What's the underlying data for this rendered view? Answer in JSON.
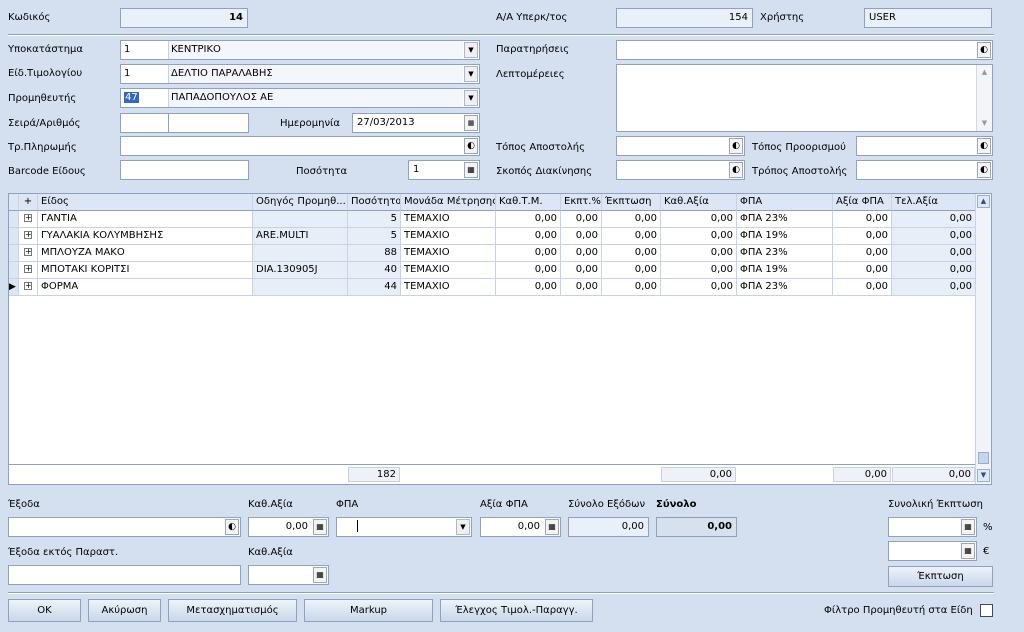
{
  "header": {
    "code_label": "Κωδικός",
    "code_value": "14",
    "aa_label": "Α/Α Υπερκ/τος",
    "aa_value": "154",
    "user_label": "Χρήστης",
    "user_value": "USER"
  },
  "form": {
    "branch_label": "Υποκατάστημα",
    "branch_code": "1",
    "branch_value": "ΚΕΝΤΡΙΚΟ",
    "invtype_label": "Είδ.Τιμολογίου",
    "invtype_code": "1",
    "invtype_value": "ΔΕΛΤΙΟ ΠΑΡΑΛΑΒΗΣ",
    "supplier_label": "Προμηθευτής",
    "supplier_code": "47",
    "supplier_value": "ΠΑΠΑΔΟΠΟΥΛΟΣ ΑΕ",
    "series_label": "Σειρά/Αριθμός",
    "series_value": "",
    "number_value": "",
    "date_label": "Ημερομηνία",
    "date_value": "27/03/2013",
    "payment_label": "Τρ.Πληρωμής",
    "payment_value": "",
    "barcode_label": "Barcode Είδους",
    "barcode_value": "",
    "qty_label": "Ποσότητα",
    "qty_value": "1",
    "notes_label": "Παρατηρήσεις",
    "notes_value": "",
    "details_label": "Λεπτομέρειες",
    "details_value": "",
    "ship_place_label": "Τόπος Αποστολής",
    "ship_place_value": "",
    "dest_place_label": "Τόπος Προορισμού",
    "dest_place_value": "",
    "purpose_label": "Σκοπός Διακίνησης",
    "purpose_value": "",
    "ship_method_label": "Τρόπος Αποστολής",
    "ship_method_value": ""
  },
  "grid": {
    "columns": [
      "+",
      "Είδος",
      "Οδηγός Προμηθ...",
      "Ποσότητα",
      "Μονάδα Μέτρησης",
      "Καθ.Τ.Μ.",
      "Εκπτ.%",
      "Έκπτωση",
      "Καθ.Αξία",
      "ΦΠΑ",
      "Αξία ΦΠΑ",
      "Τελ.Αξία"
    ],
    "rows": [
      {
        "item": "ΓΑΝΤΙΑ",
        "guide": "",
        "qty": "5",
        "unit": "ΤΕΜΑΧΙΟ",
        "price": "0,00",
        "disc_pct": "0,00",
        "disc": "0,00",
        "net": "0,00",
        "vat": "ΦΠΑ 23%",
        "vat_val": "0,00",
        "total": "0,00"
      },
      {
        "item": "ΓΥΑΛΑΚΙΑ ΚΟΛΥΜΒΗΣΗΣ",
        "guide": "ARE.MULTI",
        "qty": "5",
        "unit": "ΤΕΜΑΧΙΟ",
        "price": "0,00",
        "disc_pct": "0,00",
        "disc": "0,00",
        "net": "0,00",
        "vat": "ΦΠΑ 19%",
        "vat_val": "0,00",
        "total": "0,00"
      },
      {
        "item": "ΜΠΛΟΥΖΑ ΜΑΚΟ",
        "guide": "",
        "qty": "88",
        "unit": "ΤΕΜΑΧΙΟ",
        "price": "0,00",
        "disc_pct": "0,00",
        "disc": "0,00",
        "net": "0,00",
        "vat": "ΦΠΑ 23%",
        "vat_val": "0,00",
        "total": "0,00"
      },
      {
        "item": "ΜΠΟΤΑΚΙ ΚΟΡΙΤΣΙ",
        "guide": "DIA.130905J",
        "qty": "40",
        "unit": "ΤΕΜΑΧΙΟ",
        "price": "0,00",
        "disc_pct": "0,00",
        "disc": "0,00",
        "net": "0,00",
        "vat": "ΦΠΑ 19%",
        "vat_val": "0,00",
        "total": "0,00"
      },
      {
        "item": "ΦΟΡΜΑ",
        "guide": "",
        "qty": "44",
        "unit": "ΤΕΜΑΧΙΟ",
        "price": "0,00",
        "disc_pct": "0,00",
        "disc": "0,00",
        "net": "0,00",
        "vat": "ΦΠΑ 23%",
        "vat_val": "0,00",
        "total": "0,00"
      }
    ],
    "footer": {
      "qty_total": "182",
      "net_total": "0,00",
      "vat_total": "0,00",
      "grand_total": "0,00"
    }
  },
  "expenses": {
    "expenses_label": "Έξοδα",
    "expenses_value": "",
    "net_label": "Καθ.Αξία",
    "net_value": "0,00",
    "vat_label": "ΦΠΑ",
    "vat_value": "",
    "vat_amount_label": "Αξία ΦΠΑ",
    "vat_amount_value": "0,00",
    "exp_total_label": "Σύνολο Εξόδων",
    "exp_total_value": "0,00",
    "total_label": "Σύνολο",
    "total_value": "0,00",
    "overall_disc_label": "Συνολική Έκπτωση",
    "pct_symbol": "%",
    "euro_symbol": "€",
    "disc_pct_value": "",
    "disc_euro_value": "",
    "disc_button": "Έκπτωση",
    "outside_label": "Έξοδα εκτός Παραστ.",
    "outside_value": "",
    "outside_net_label": "Καθ.Αξία",
    "outside_net_value": ""
  },
  "buttons": {
    "ok": "OK",
    "cancel": "Ακύρωση",
    "transform": "Μετασχηματισμός",
    "markup": "Markup",
    "check": "Έλεγχος Τιμολ.-Παραγγ.",
    "filter_label": "Φίλτρο Προμηθευτή στα Είδη"
  }
}
